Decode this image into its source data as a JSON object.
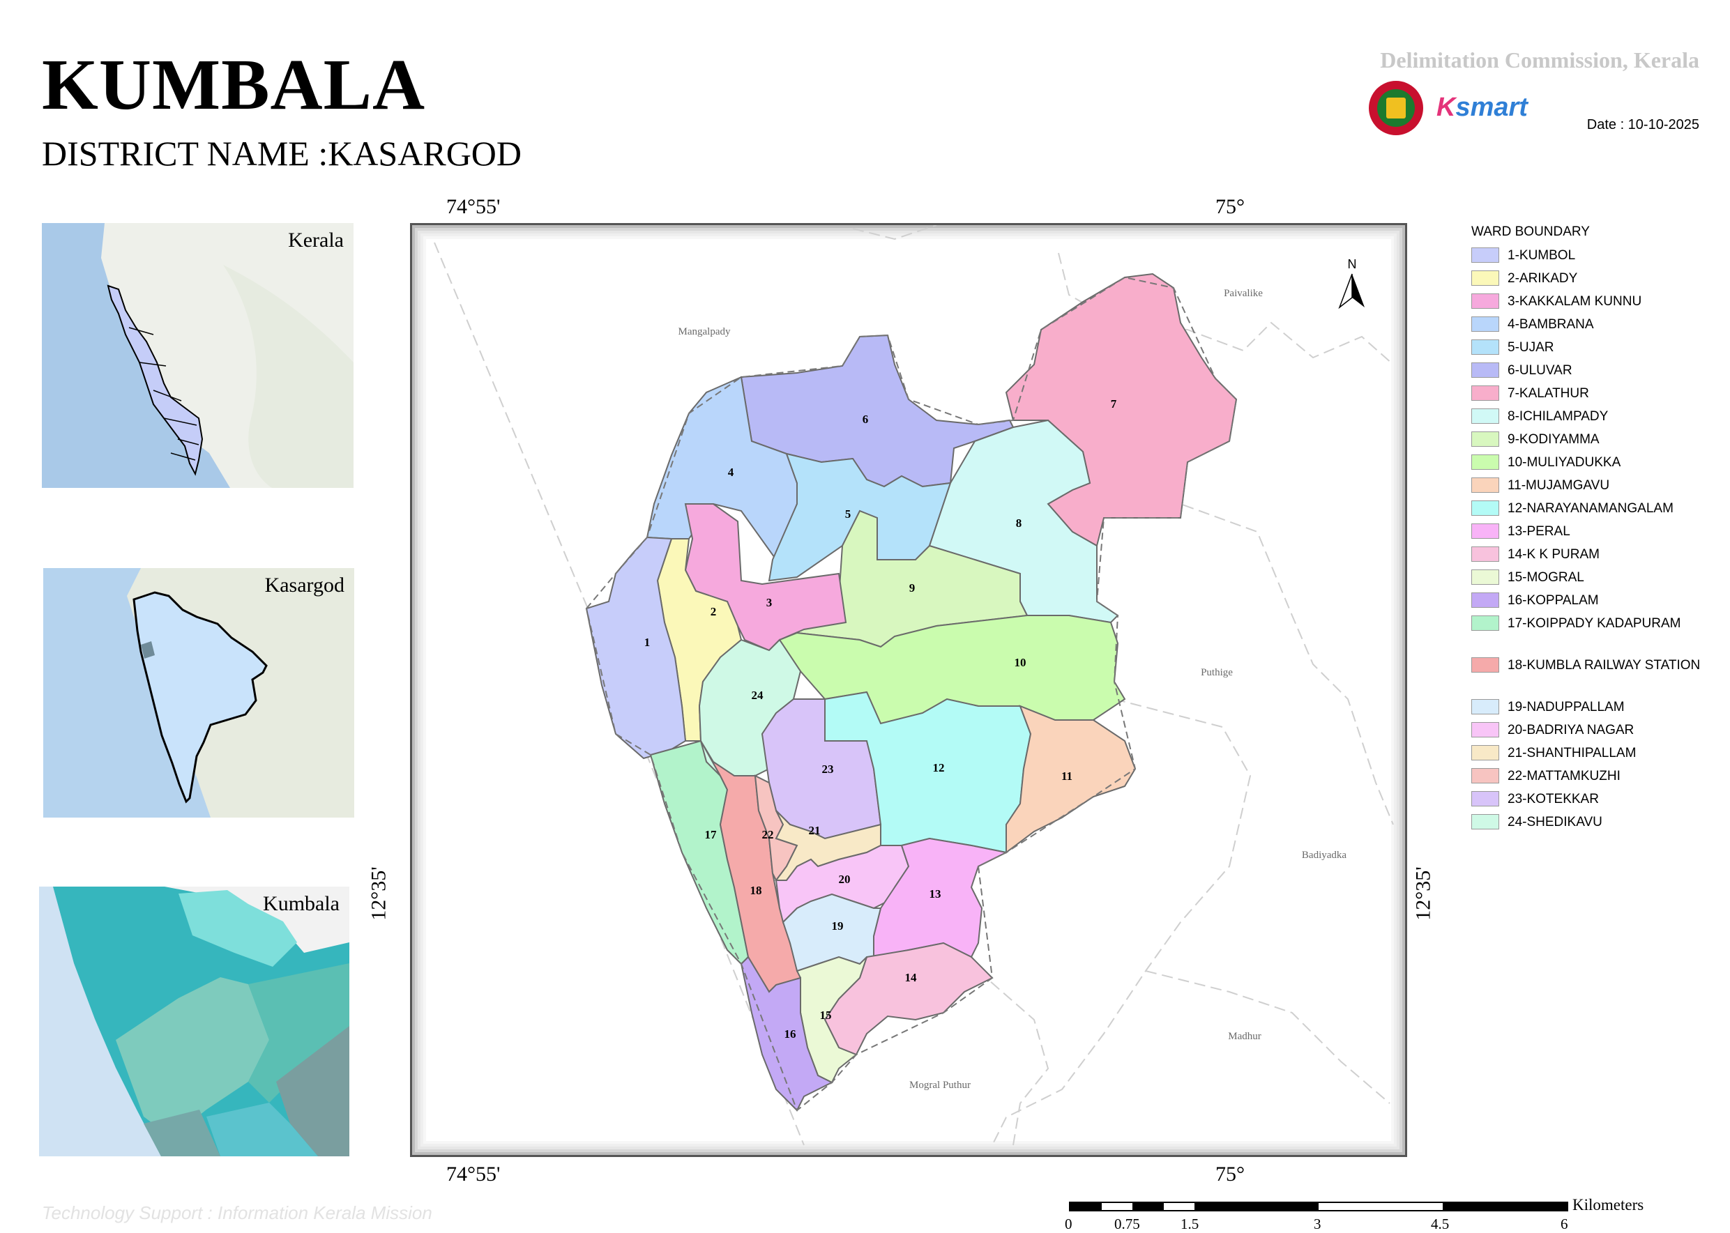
{
  "header": {
    "title": "KUMBALA",
    "district_line": "DISTRICT NAME :KASARGOD",
    "commission": "Delimitation Commission, Kerala",
    "ksmart_k": "K",
    "ksmart_rest": "smart",
    "date": "Date : 10-10-2025"
  },
  "insets": {
    "kerala": "Kerala",
    "kasargod": "Kasargod",
    "kumbala": "Kumbala"
  },
  "map": {
    "coord_top_left": "74°55'",
    "coord_top_right": "75°",
    "coord_bottom_left": "74°55'",
    "coord_bottom_right": "75°",
    "coord_left": "12°35'",
    "coord_right": "12°35'",
    "north_label": "N",
    "places": [
      "Mangalpady",
      "Paivalike",
      "Puthige",
      "Badiyadka",
      "Madhur",
      "Mogral Puthur"
    ]
  },
  "legend": {
    "title": "WARD BOUNDARY",
    "items": [
      {
        "label": "1-KUMBOL",
        "color": "#c7cdfa"
      },
      {
        "label": "2-ARIKADY",
        "color": "#fbf8b9"
      },
      {
        "label": "3-KAKKALAM KUNNU",
        "color": "#f6a9dd"
      },
      {
        "label": "4-BAMBRANA",
        "color": "#b9d6fb"
      },
      {
        "label": "5-UJAR",
        "color": "#b4e2fa"
      },
      {
        "label": "6-ULUVAR",
        "color": "#b8baf6"
      },
      {
        "label": "7-KALATHUR",
        "color": "#f8aecb"
      },
      {
        "label": "8-ICHILAMPADY",
        "color": "#d1f9f6"
      },
      {
        "label": "9-KODIYAMMA",
        "color": "#d8f7bf"
      },
      {
        "label": "10-MULIYADUKKA",
        "color": "#cafcae"
      },
      {
        "label": "11-MUJAMGAVU",
        "color": "#fad4bb"
      },
      {
        "label": "12-NARAYANAMANGALAM",
        "color": "#b3fbf6"
      },
      {
        "label": "13-PERAL",
        "color": "#f8b3f7"
      },
      {
        "label": "14-K K PURAM",
        "color": "#f8c2dd"
      },
      {
        "label": "15-MOGRAL",
        "color": "#ebf9d6"
      },
      {
        "label": "16-KOPPALAM",
        "color": "#c3a9f5"
      },
      {
        "label": "17-KOIPPADY KADAPURAM",
        "color": "#b2f3cb"
      },
      {
        "label": "18-KUMBLA RAILWAY STATION",
        "color": "#f5aaaa"
      },
      {
        "label": "19-NADUPPALLAM",
        "color": "#d8ecfb"
      },
      {
        "label": "20-BADRIYA NAGAR",
        "color": "#f8c5f7"
      },
      {
        "label": "21-SHANTHIPALLAM",
        "color": "#f8e9c7"
      },
      {
        "label": "22-MATTAMKUZHI",
        "color": "#f7c4c1"
      },
      {
        "label": "23-KOTEKKAR",
        "color": "#d8c4f9"
      },
      {
        "label": "24-SHEDIKAVU",
        "color": "#cff9e6"
      }
    ]
  },
  "scale": {
    "unit": "Kilometers",
    "ticks": [
      "0",
      "0.75",
      "1.5",
      "3",
      "4.5",
      "6"
    ]
  },
  "footer": {
    "tech_support": "Technology Support : Information Kerala Mission"
  }
}
